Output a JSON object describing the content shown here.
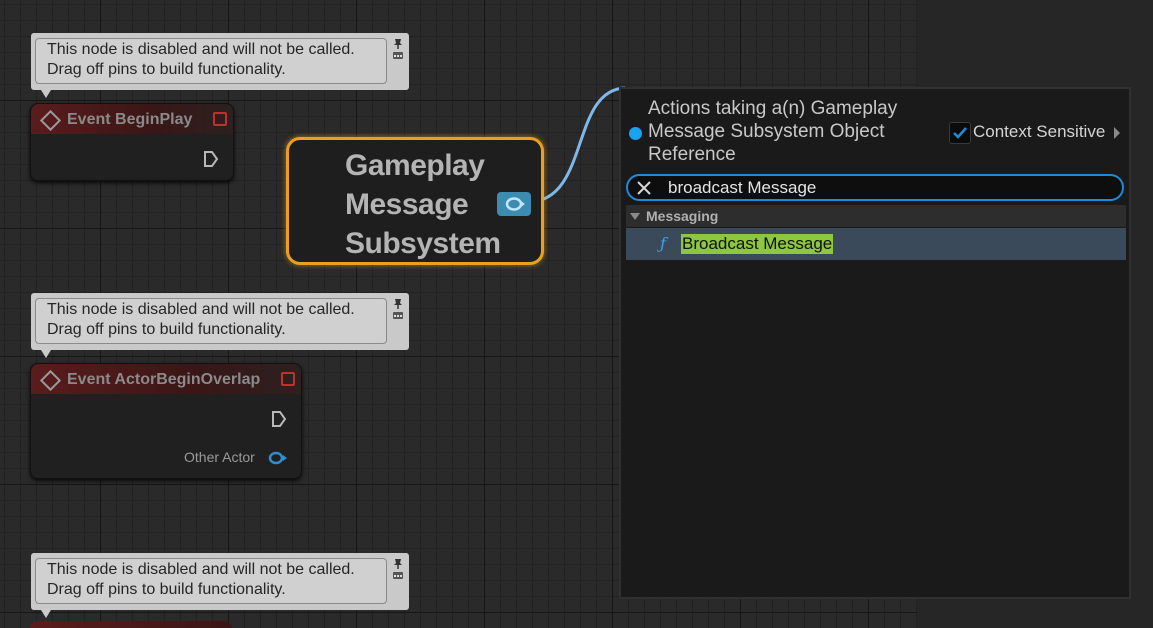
{
  "comments": [
    {
      "line1": "This node is disabled and will not be called.",
      "line2": "Drag off pins to build functionality."
    },
    {
      "line1": "This node is disabled and will not be called.",
      "line2": "Drag off pins to build functionality."
    },
    {
      "line1": "This node is disabled and will not be called.",
      "line2": "Drag off pins to build functionality."
    }
  ],
  "nodes": {
    "begin_play": {
      "title": "Event BeginPlay"
    },
    "begin_overlap": {
      "title": "Event ActorBeginOverlap",
      "pin_label": "Other Actor"
    },
    "subsystem": {
      "line1": "Gameplay",
      "line2": "Message",
      "line3": "Subsystem"
    }
  },
  "action_menu": {
    "header_line1": "Actions taking a(n) Gameplay",
    "header_line2": "Message Subsystem Object",
    "header_line3": "Reference",
    "context_sensitive_label": "Context Sensitive",
    "context_sensitive_checked": true,
    "search_value": "broadcast Message",
    "category": "Messaging",
    "result": "Broadcast Message",
    "result_icon": "function-icon"
  },
  "colors": {
    "accent_blue": "#1d8bd8",
    "selection_orange": "#e8a020",
    "highlight_green": "#8dc63f",
    "object_pin": "#3c8bb0"
  }
}
